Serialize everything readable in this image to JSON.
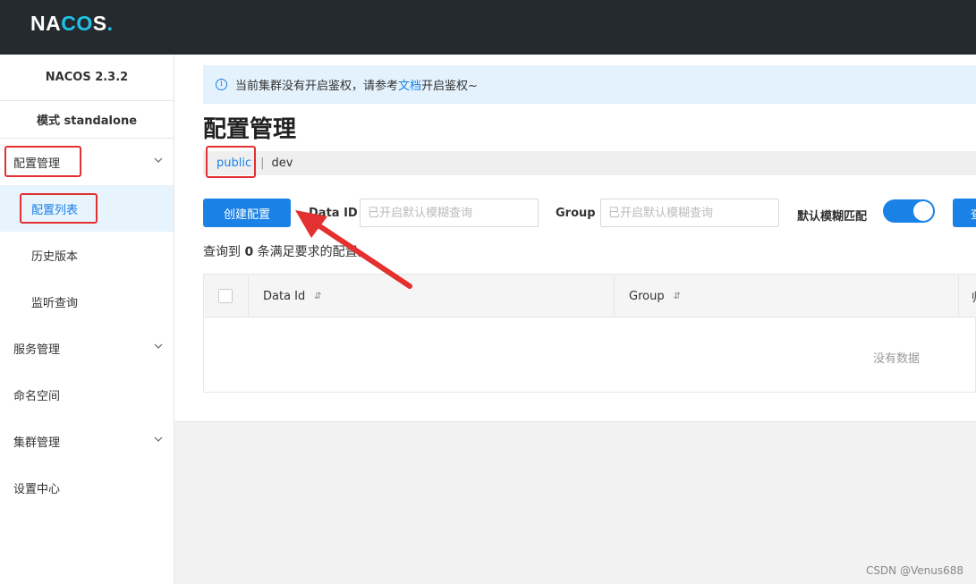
{
  "topbar": {
    "logo_pre": "NA",
    "logo_c": "C",
    "logo_o": "O",
    "logo_post": "S",
    "logo_dot": "."
  },
  "sidebar": {
    "version": "NACOS 2.3.2",
    "mode": "模式 standalone",
    "items": [
      {
        "label": "配置管理",
        "expandable": true
      },
      {
        "label": "配置列表",
        "active": true
      },
      {
        "label": "历史版本"
      },
      {
        "label": "监听查询"
      },
      {
        "label": "服务管理",
        "expandable": true
      },
      {
        "label": "命名空间"
      },
      {
        "label": "集群管理",
        "expandable": true
      },
      {
        "label": "设置中心"
      }
    ]
  },
  "notice": {
    "text_before": "当前集群没有开启鉴权，请参考",
    "link": "文档",
    "text_after": "开启鉴权~"
  },
  "page_title": "配置管理",
  "namespaces": {
    "current": "public",
    "separator": "|",
    "other": "dev"
  },
  "toolbar": {
    "create_label": "创建配置",
    "data_id_label": "Data ID",
    "data_id_placeholder": "已开启默认模糊查询",
    "group_label": "Group",
    "group_placeholder": "已开启默认模糊查询",
    "fuzzy_label": "默认模糊匹配",
    "fuzzy_on": true,
    "query_label": "查"
  },
  "result": {
    "prefix": "查询到 ",
    "count": "0",
    "suffix": " 条满足要求的配置。"
  },
  "table": {
    "columns": [
      "Data Id",
      "Group",
      "归"
    ],
    "empty_text": "没有数据"
  },
  "watermark": "CSDN @Venus688",
  "colors": {
    "accent": "#1a82e6",
    "topbar": "#252a2f",
    "annotation": "#e33030"
  }
}
